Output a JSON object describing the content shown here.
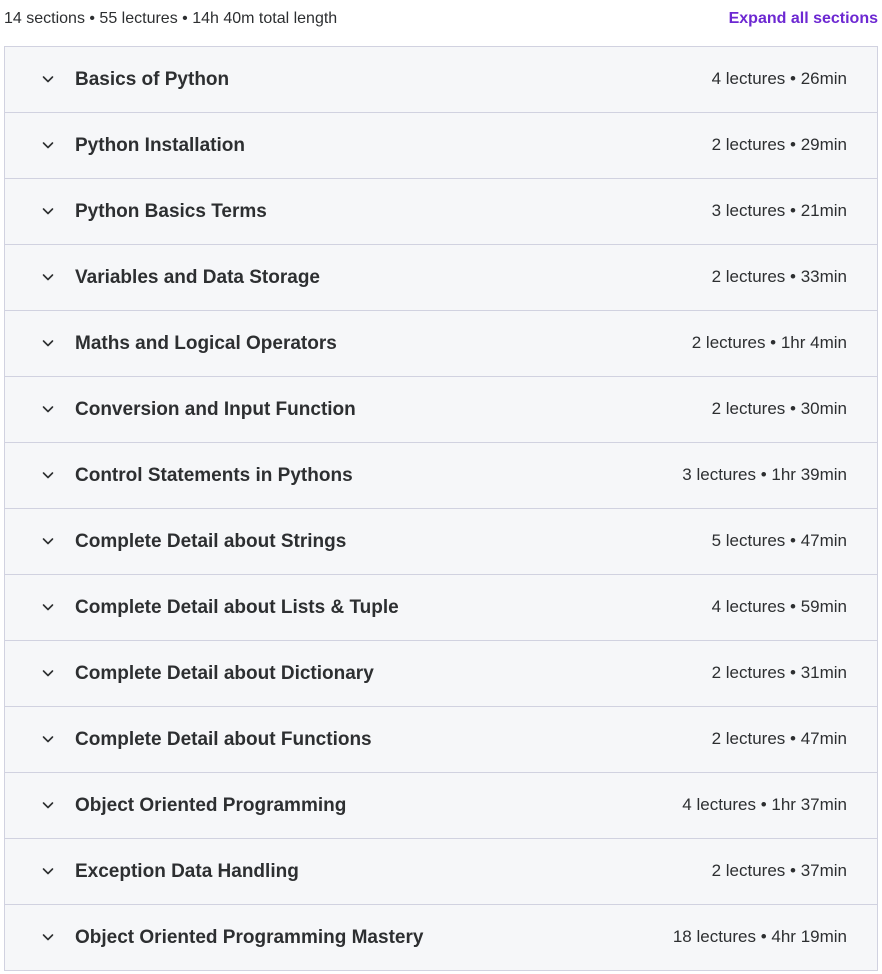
{
  "header": {
    "summary": "14 sections • 55 lectures • 14h 40m total length",
    "expand_all_label": "Expand all sections"
  },
  "icons": {
    "section_toggle": "chevron-down-icon"
  },
  "colors": {
    "accent": "#6d28d2",
    "section_bg": "#f6f7f9",
    "border": "#d1d2e0",
    "text": "#2d2f31"
  },
  "sections": [
    {
      "title": "Basics of Python",
      "meta": "4 lectures • 26min"
    },
    {
      "title": "Python Installation",
      "meta": "2 lectures • 29min"
    },
    {
      "title": "Python Basics Terms",
      "meta": "3 lectures • 21min"
    },
    {
      "title": "Variables and Data Storage",
      "meta": "2 lectures • 33min"
    },
    {
      "title": "Maths and Logical Operators",
      "meta": "2 lectures • 1hr 4min"
    },
    {
      "title": "Conversion and Input Function",
      "meta": "2 lectures • 30min"
    },
    {
      "title": "Control Statements in Pythons",
      "meta": "3 lectures • 1hr 39min"
    },
    {
      "title": "Complete Detail about Strings",
      "meta": "5 lectures • 47min"
    },
    {
      "title": "Complete Detail about Lists & Tuple",
      "meta": "4 lectures • 59min"
    },
    {
      "title": "Complete Detail about Dictionary",
      "meta": "2 lectures • 31min"
    },
    {
      "title": "Complete Detail about Functions",
      "meta": "2 lectures • 47min"
    },
    {
      "title": "Object Oriented Programming",
      "meta": "4 lectures • 1hr 37min"
    },
    {
      "title": "Exception Data Handling",
      "meta": "2 lectures • 37min"
    },
    {
      "title": "Object Oriented Programming Mastery",
      "meta": "18 lectures • 4hr 19min"
    }
  ]
}
